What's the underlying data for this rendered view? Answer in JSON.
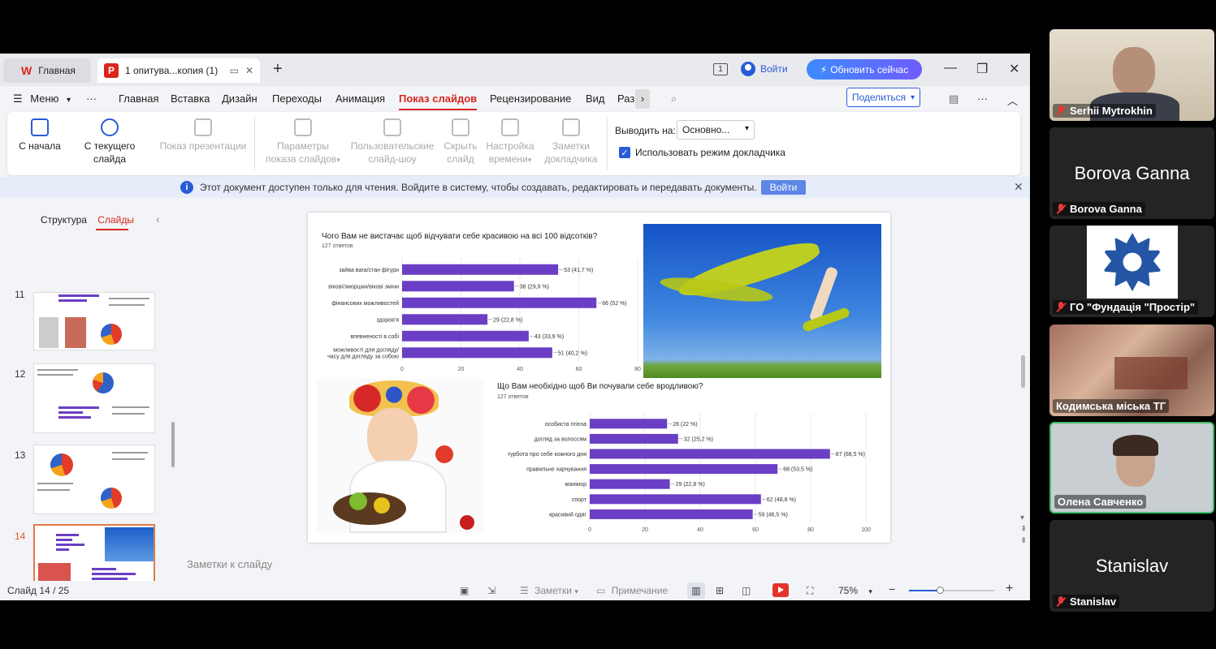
{
  "tabs": {
    "home": "Главная",
    "doc": "1 опитува...копия (1)",
    "doc_badge": "P"
  },
  "titlebar": {
    "badge": "1",
    "login": "Войти",
    "update": "Обновить сейчас"
  },
  "menu": {
    "hamburger": "Меню",
    "items": [
      "Главная",
      "Вставка",
      "Дизайн",
      "Переходы",
      "Анимация",
      "Показ слайдов",
      "Рецензирование",
      "Вид",
      "Раз"
    ],
    "share": "Поделиться"
  },
  "ribbon": {
    "from_start": "С начала",
    "from_current": "С текущего слайда",
    "show_presentation": "Показ презентации",
    "slideshow_params_1": "Параметры",
    "slideshow_params_2": "показа слайдов",
    "custom_1": "Пользовательские",
    "custom_2": "слайд-шоу",
    "hide_1": "Скрыть",
    "hide_2": "слайд",
    "timing_1": "Настройка",
    "timing_2": "времени",
    "notes_1": "Заметки",
    "notes_2": "докладчика",
    "output_label": "Выводить на:",
    "output_value": "Основно...",
    "presenter_mode": "Использовать режим докладчика"
  },
  "infobar": {
    "text": "Этот документ доступен только для чтения. Войдите в систему, чтобы создавать, редактировать и передавать документы.",
    "login": "Войти"
  },
  "left_panel": {
    "tab_structure": "Структура",
    "tab_slides": "Слайды",
    "slide_numbers": [
      "11",
      "12",
      "13",
      "14"
    ]
  },
  "slide": {
    "chart1_title": "Чого Вам не вистачає щоб відчувати себе красивою на всі 100 відсотків?",
    "chart1_sub": "127 ответов",
    "chart2_title": "Що Вам необхідно щоб Ви почували себе вродливою?",
    "chart2_sub": "127 ответов"
  },
  "chart_data": [
    {
      "type": "bar",
      "orientation": "horizontal",
      "title": "Чого Вам не вистачає щоб відчувати себе красивою на всі 100 відсотків?",
      "subtitle": "127 ответов",
      "categories": [
        "зайва вага/стан фігури",
        "вікові/зморшки/вікові зміни",
        "фінансових можливостей",
        "здоров'я",
        "впевненості в собі",
        "можливості для догляду/ часу для догляду за собою"
      ],
      "values": [
        53,
        38,
        66,
        29,
        43,
        51
      ],
      "labels": [
        "53 (41,7 %)",
        "38 (29,9 %)",
        "66 (52 %)",
        "29 (22,8 %)",
        "43 (33,9 %)",
        "51 (40,2 %)"
      ],
      "xlim": [
        0,
        80
      ],
      "ticks": [
        "0",
        "20",
        "40",
        "60",
        "80"
      ],
      "color": "#6a3fc5"
    },
    {
      "type": "bar",
      "orientation": "horizontal",
      "title": "Що Вам необхідно щоб Ви почували себе вродливою?",
      "subtitle": "127 ответов",
      "categories": [
        "особиста гігієна",
        "догляд за волоссям",
        "турбота про себе кожного дня",
        "правильне харчування",
        "манікюр",
        "спорт",
        "красивий одяг"
      ],
      "values": [
        28,
        32,
        87,
        68,
        29,
        62,
        59
      ],
      "labels": [
        "28 (22 %)",
        "32 (25,2 %)",
        "87 (68,5 %)",
        "68 (53,5 %)",
        "29 (22,8 %)",
        "62 (48,8 %)",
        "59 (46,5 %)"
      ],
      "xlim": [
        0,
        100
      ],
      "ticks": [
        "0",
        "20",
        "40",
        "60",
        "80",
        "100"
      ],
      "color": "#6a3fc5"
    }
  ],
  "notes_placeholder": "Заметки к слайду",
  "status": {
    "slide_count": "Слайд 14 / 25",
    "notes": "Заметки",
    "comment": "Примечание",
    "zoom": "75%",
    "zoom_fraction": 0.36
  },
  "participants": [
    {
      "name": "Serhii Mytrokhin",
      "big": ""
    },
    {
      "name": "Borova Ganna",
      "big": "Borova Ganna"
    },
    {
      "name": "ГО \"Фундація \"Простір\"",
      "big": ""
    },
    {
      "name": "Кодимська міська ТГ",
      "big": ""
    },
    {
      "name": "Олена Савченко",
      "big": ""
    },
    {
      "name": "Stanislav",
      "big": "Stanislav"
    }
  ]
}
